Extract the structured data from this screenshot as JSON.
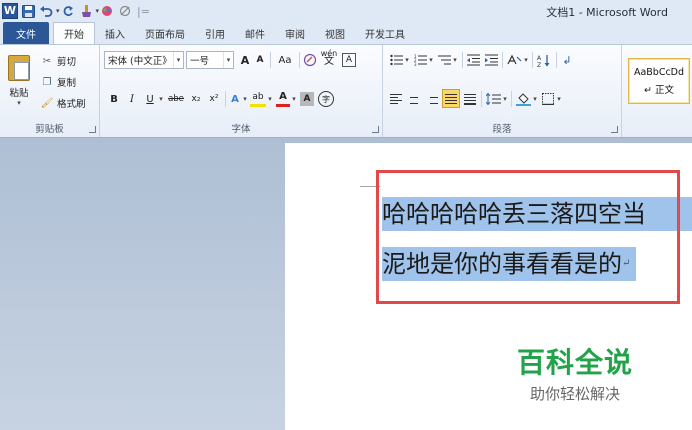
{
  "window": {
    "title": "文档1 - Microsoft Word",
    "qat": {
      "app_icon": "W",
      "undo_icon": "undo-icon",
      "redo_icon": "redo-icon",
      "customize_symbol": "|="
    }
  },
  "tabs": [
    {
      "label": "文件"
    },
    {
      "label": "开始"
    },
    {
      "label": "插入"
    },
    {
      "label": "页面布局"
    },
    {
      "label": "引用"
    },
    {
      "label": "邮件"
    },
    {
      "label": "审阅"
    },
    {
      "label": "视图"
    },
    {
      "label": "开发工具"
    }
  ],
  "clipboard": {
    "paste": "粘贴",
    "cut": "剪切",
    "copy": "复制",
    "format_painter": "格式刷",
    "group_label": "剪贴板"
  },
  "font": {
    "font_name": "宋体 (中文正》",
    "font_size": "一号",
    "grow": "A",
    "shrink": "A",
    "change_case": "Aa",
    "clear_format_icon": "eraser-icon",
    "phonetic": "wén",
    "char_border": "A",
    "bold": "B",
    "italic": "I",
    "underline": "U",
    "strikethrough": "abe",
    "subscript": "x₂",
    "superscript": "x²",
    "text_effect": "A",
    "highlight": "ab",
    "font_color": "A",
    "char_shading": "A",
    "enclose": "字",
    "group_label": "字体"
  },
  "paragraph": {
    "group_label": "段落"
  },
  "styles": {
    "preview": "AaBbCcDd",
    "normal": "↵ 正文"
  },
  "document": {
    "line1": "哈哈哈哈哈丢三落四空当",
    "line2": "泥地是你的事看看是的",
    "paragraph_mark": "↵"
  },
  "watermark": {
    "title": "百科全说",
    "subtitle": "助你轻松解决"
  },
  "colors": {
    "file_tab": "#2b5797",
    "selection": "#9fc3ea",
    "annotation_box": "#e24a4a",
    "watermark_green": "#22a34a"
  }
}
